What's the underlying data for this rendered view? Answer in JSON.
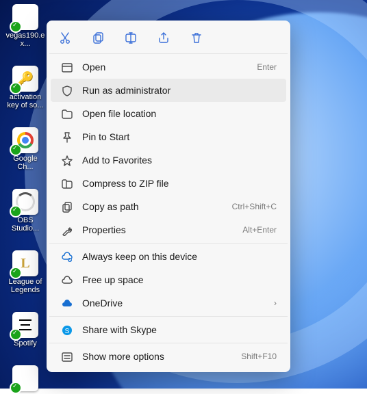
{
  "desktop_icons": [
    {
      "label": "vegas190.ex..."
    },
    {
      "label": "activation key of so..."
    },
    {
      "label": "Google Ch..."
    },
    {
      "label": "OBS Studio..."
    },
    {
      "label": "League of Legends"
    },
    {
      "label": "Spotify"
    },
    {
      "label": ""
    }
  ],
  "toolbar": {
    "cut": "cut-icon",
    "copy": "copy-icon",
    "rename": "rename-icon",
    "share": "share-icon",
    "delete": "delete-icon"
  },
  "menu": [
    {
      "label": "Open",
      "shortcut": "Enter"
    },
    {
      "label": "Run as administrator",
      "shortcut": ""
    },
    {
      "label": "Open file location",
      "shortcut": ""
    },
    {
      "label": "Pin to Start",
      "shortcut": ""
    },
    {
      "label": "Add to Favorites",
      "shortcut": ""
    },
    {
      "label": "Compress to ZIP file",
      "shortcut": ""
    },
    {
      "label": "Copy as path",
      "shortcut": "Ctrl+Shift+C"
    },
    {
      "label": "Properties",
      "shortcut": "Alt+Enter"
    },
    {
      "label": "Always keep on this device",
      "shortcut": ""
    },
    {
      "label": "Free up space",
      "shortcut": ""
    },
    {
      "label": "OneDrive",
      "shortcut": "",
      "submenu": true
    },
    {
      "label": "Share with Skype",
      "shortcut": ""
    },
    {
      "label": "Show more options",
      "shortcut": "Shift+F10"
    }
  ]
}
